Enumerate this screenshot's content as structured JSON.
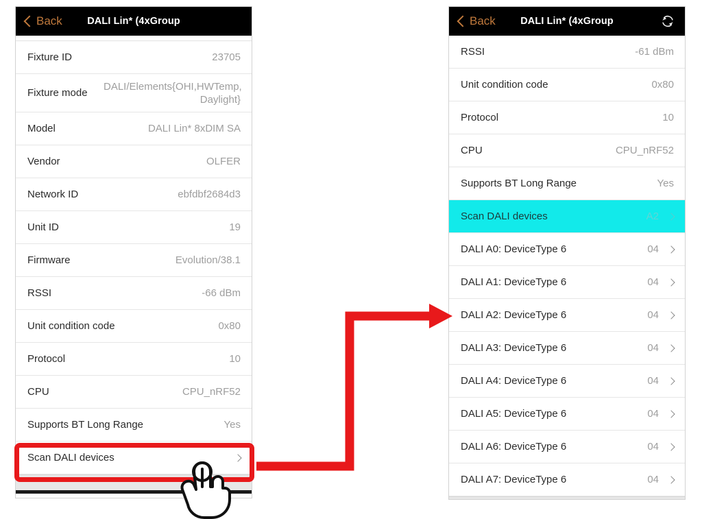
{
  "left_panel": {
    "navbar": {
      "back_label": "Back",
      "title": "DALI Lin* (4xGroup",
      "back_icon": "chevron-left-icon"
    },
    "rows": [
      {
        "label": "Fixture ID",
        "value": "23705"
      },
      {
        "label": "Fixture mode",
        "value": "DALI/Elements{OHI,HWTemp, Daylight}"
      },
      {
        "label": "Model",
        "value": "DALI Lin* 8xDIM SA"
      },
      {
        "label": "Vendor",
        "value": "OLFER"
      },
      {
        "label": "Network ID",
        "value": "ebfdbf2684d3"
      },
      {
        "label": "Unit ID",
        "value": "19"
      },
      {
        "label": "Firmware",
        "value": "Evolution/38.1"
      },
      {
        "label": "RSSI",
        "value": "-66 dBm"
      },
      {
        "label": "Unit condition code",
        "value": "0x80"
      },
      {
        "label": "Protocol",
        "value": "10"
      },
      {
        "label": "CPU",
        "value": "CPU_nRF52"
      },
      {
        "label": "Supports BT Long Range",
        "value": "Yes"
      },
      {
        "label": "Scan DALI devices",
        "value": ""
      }
    ]
  },
  "right_panel": {
    "navbar": {
      "back_label": "Back",
      "title": "DALI Lin* (4xGroup",
      "back_icon": "chevron-left-icon",
      "refresh_icon": "refresh-icon"
    },
    "rows": [
      {
        "label": "RSSI",
        "value": "-61 dBm"
      },
      {
        "label": "Unit condition code",
        "value": "0x80"
      },
      {
        "label": "Protocol",
        "value": "10"
      },
      {
        "label": "CPU",
        "value": "CPU_nRF52"
      },
      {
        "label": "Supports BT Long Range",
        "value": "Yes"
      },
      {
        "label": "Scan DALI devices",
        "value": "A2"
      },
      {
        "label": "DALI A0: DeviceType 6",
        "value": "04"
      },
      {
        "label": "DALI A1: DeviceType 6",
        "value": "04"
      },
      {
        "label": "DALI A2: DeviceType 6",
        "value": "04"
      },
      {
        "label": "DALI A3: DeviceType 6",
        "value": "04"
      },
      {
        "label": "DALI A4: DeviceType 6",
        "value": "04"
      },
      {
        "label": "DALI A5: DeviceType 6",
        "value": "04"
      },
      {
        "label": "DALI A6: DeviceType 6",
        "value": "04"
      },
      {
        "label": "DALI A7: DeviceType 6",
        "value": "04"
      }
    ]
  },
  "annotations": {
    "highlight_color": "#e8191b",
    "arrow_color": "#e8191b",
    "highlight_target": "Scan DALI devices",
    "cursor_icon": "pointing-hand-cursor-icon"
  },
  "colors": {
    "navbar_bg": "#000000",
    "back_text": "#c0793c",
    "highlight_row": "#12eaea",
    "value_text": "#9e9e9e",
    "label_text": "#2b2b2b"
  }
}
